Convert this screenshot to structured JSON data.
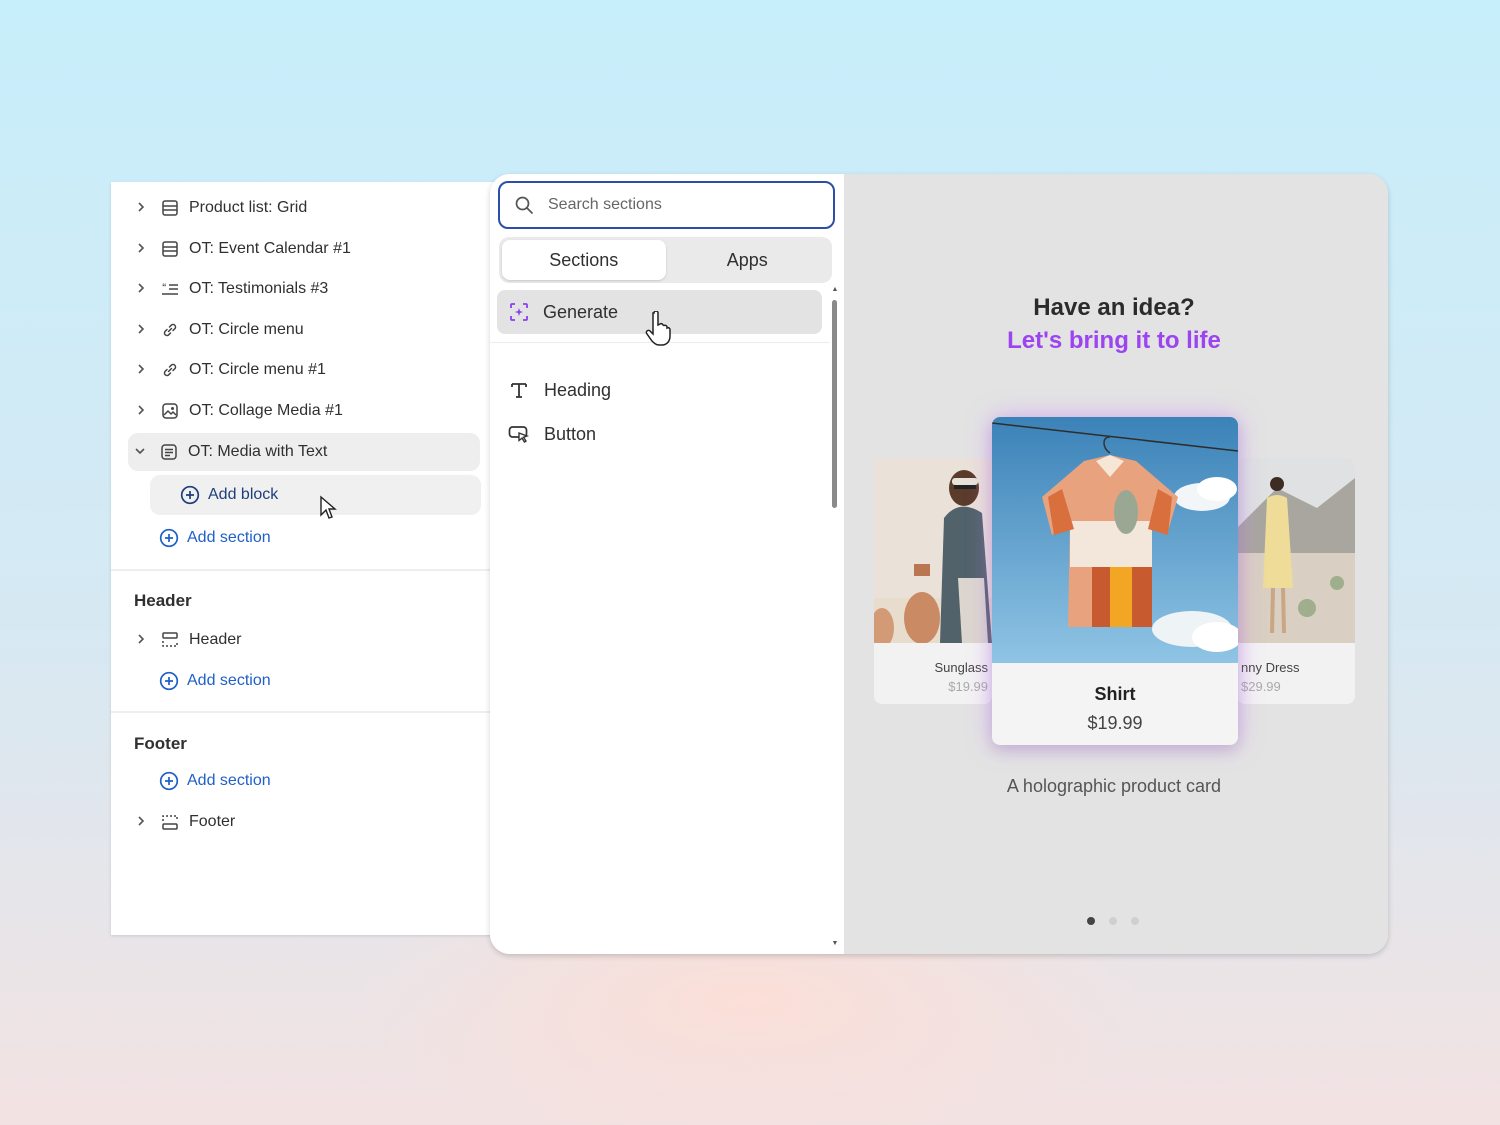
{
  "sidebar": {
    "items": [
      {
        "label": "Product list: Grid",
        "icon": "layout-grid-icon"
      },
      {
        "label": "OT: Event Calendar #1",
        "icon": "layout-grid-icon"
      },
      {
        "label": "OT: Testimonials #3",
        "icon": "testimonials-icon"
      },
      {
        "label": "OT: Circle menu",
        "icon": "link-icon"
      },
      {
        "label": "OT: Circle menu #1",
        "icon": "link-icon"
      },
      {
        "label": "OT: Collage Media #1",
        "icon": "image-icon"
      },
      {
        "label": "OT: Media with Text",
        "icon": "text-block-icon"
      }
    ],
    "add_block": "Add block",
    "add_section": "Add section",
    "header_group": {
      "title": "Header",
      "item": "Header",
      "add_section": "Add section"
    },
    "footer_group": {
      "title": "Footer",
      "add_section": "Add section",
      "item": "Footer"
    }
  },
  "picker": {
    "search_placeholder": "Search sections",
    "tabs": [
      "Sections",
      "Apps"
    ],
    "active_tab": "Sections",
    "generate": "Generate",
    "items": [
      {
        "label": "Heading",
        "icon": "text-t-icon"
      },
      {
        "label": "Button",
        "icon": "button-cursor-icon"
      }
    ]
  },
  "preview": {
    "title": "Have an idea?",
    "subtitle": "Let's bring it to life",
    "main_product": {
      "name": "Shirt",
      "price": "$19.99"
    },
    "left_product": {
      "name": "Sunglass",
      "price": "$19.99"
    },
    "right_product": {
      "name": "nny Dress",
      "price": "$29.99"
    },
    "caption": "A holographic product card",
    "carousel_pages": 3,
    "active_page": 1
  },
  "colors": {
    "accent_purple": "#9b44f0",
    "link_blue": "#1f5fc9",
    "focus_blue": "#2b4ea8"
  }
}
